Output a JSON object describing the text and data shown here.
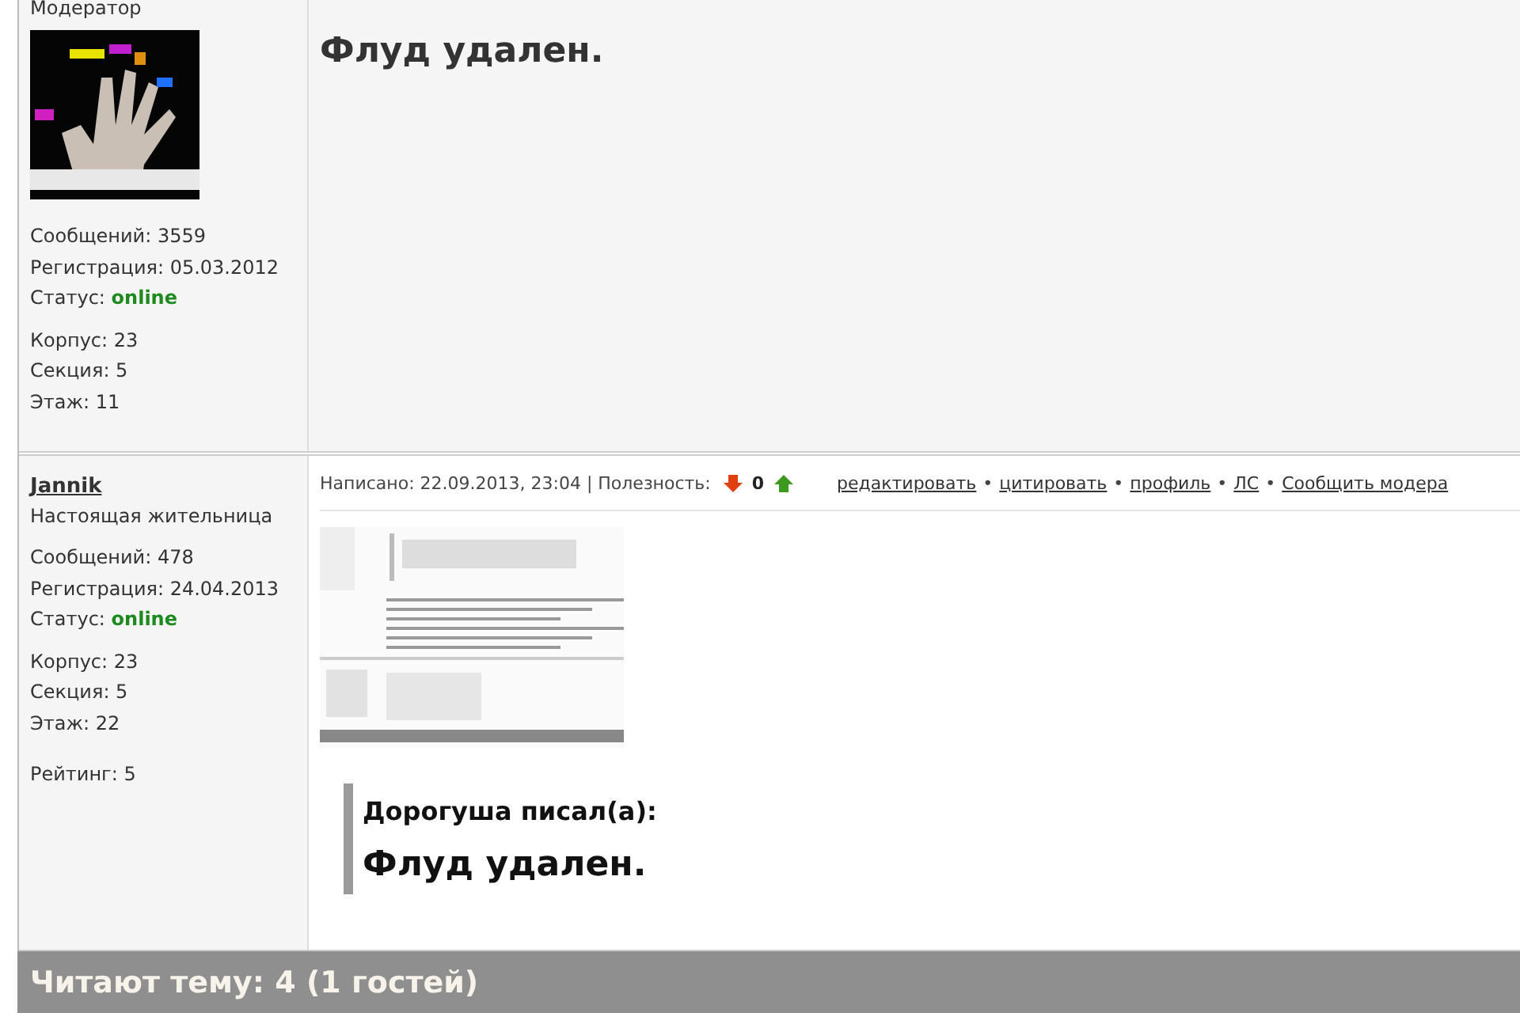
{
  "posts": [
    {
      "rank": "Модератор",
      "avatar": {
        "kind": "picture"
      },
      "info_groups": [
        [
          {
            "kind": "plain",
            "label": "Сообщений: 3559"
          },
          {
            "kind": "plain",
            "label": "Регистрация: 05.03.2012"
          },
          {
            "kind": "status",
            "label": "Статус:",
            "value": "online"
          }
        ],
        [
          {
            "kind": "plain",
            "label": "Корпус: 23"
          },
          {
            "kind": "plain",
            "label": "Секция: 5"
          },
          {
            "kind": "plain",
            "label": "Этаж: 11"
          }
        ]
      ],
      "body": {
        "kind": "big_text",
        "text": "Флуд удален."
      }
    },
    {
      "author": "Jannik",
      "rank": "Настоящая жительница",
      "info_groups": [
        [
          {
            "kind": "plain",
            "label": "Сообщений: 478"
          },
          {
            "kind": "plain",
            "label": "Регистрация: 24.04.2013"
          },
          {
            "kind": "status",
            "label": "Статус:",
            "value": "online"
          }
        ],
        [
          {
            "kind": "plain",
            "label": "Корпус: 23"
          },
          {
            "kind": "plain",
            "label": "Секция: 5"
          },
          {
            "kind": "plain",
            "label": "Этаж: 22"
          }
        ],
        [
          {
            "kind": "plain",
            "label": "Рейтинг:  5"
          }
        ]
      ],
      "header": {
        "written": "Написано: 22.09.2013, 23:04 | Полезность:",
        "votes": "0",
        "actions": [
          {
            "label": "редактировать",
            "sep": "•"
          },
          {
            "label": "цитировать",
            "sep": "•"
          },
          {
            "label": "профиль",
            "sep": "•"
          },
          {
            "label": "ЛС",
            "sep": "•"
          },
          {
            "label": "Сообщить модера"
          }
        ]
      },
      "body": {
        "kind": "quote",
        "image": {
          "kind": "picture"
        },
        "quote_author": "Дорогуша писал(а):",
        "quote_text": "Флуд удален."
      }
    }
  ],
  "footer": {
    "title": "Читают тему: 4 (1 гостей)"
  }
}
